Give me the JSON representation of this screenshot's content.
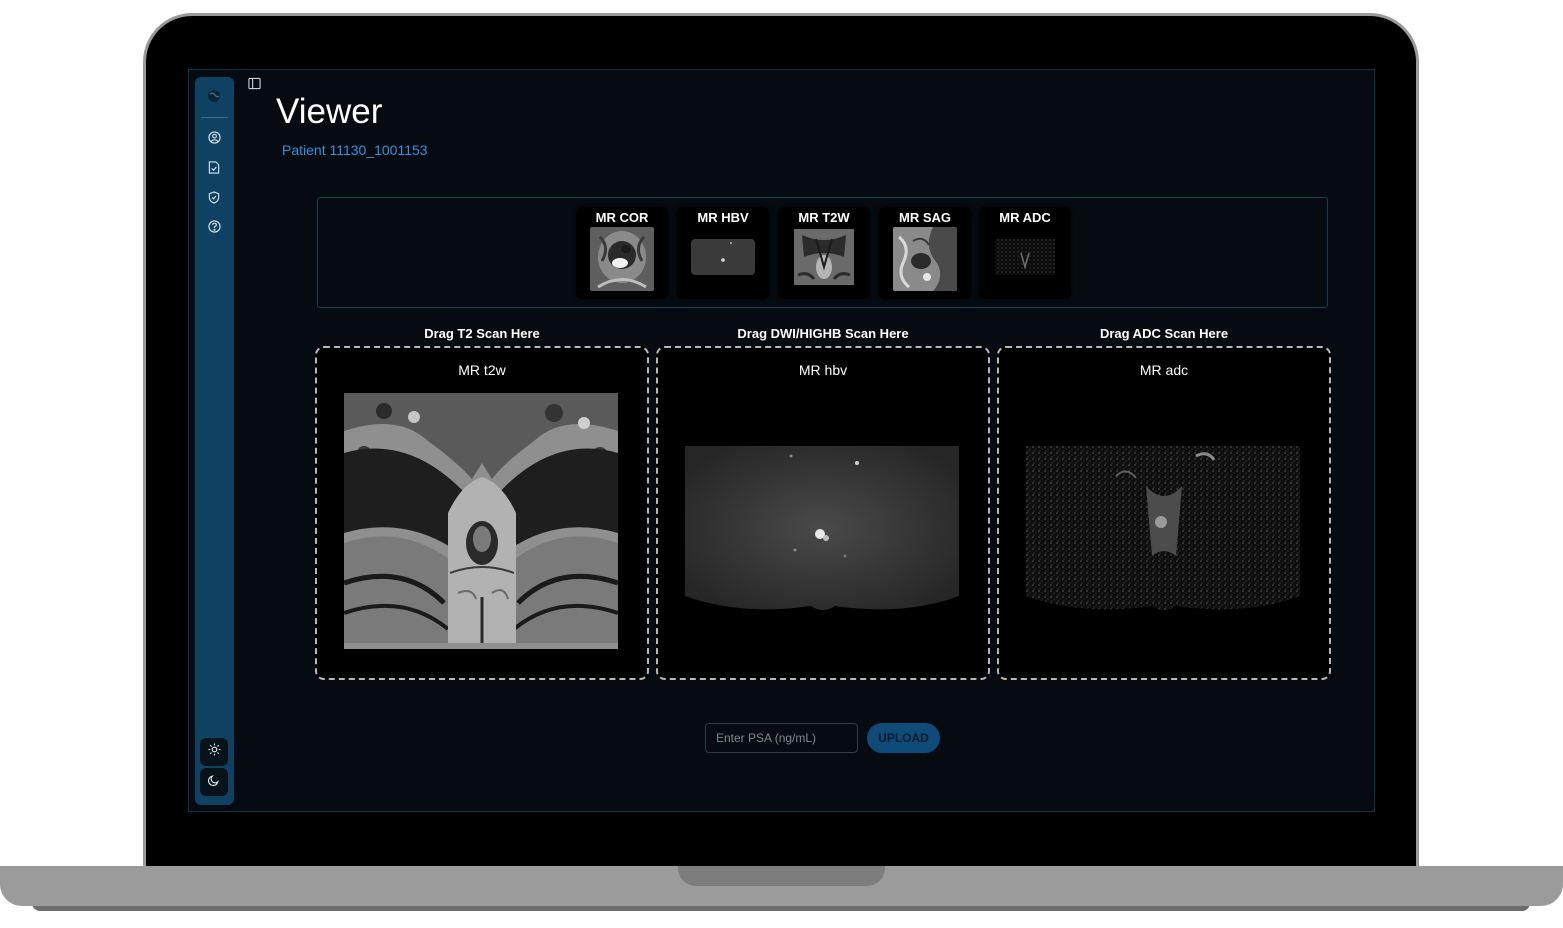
{
  "page": {
    "title": "Viewer",
    "patient": "Patient 11130_1001153"
  },
  "sidebar": {
    "items": [
      {
        "icon": "globe-icon"
      },
      {
        "icon": "user-circle-icon"
      },
      {
        "icon": "file-check-icon"
      },
      {
        "icon": "shield-icon"
      },
      {
        "icon": "help-circle-icon"
      }
    ],
    "theme_buttons": [
      {
        "icon": "sun-icon"
      },
      {
        "icon": "moon-icon"
      }
    ]
  },
  "series": [
    {
      "label": "MR COR"
    },
    {
      "label": "MR HBV"
    },
    {
      "label": "MR T2W"
    },
    {
      "label": "MR SAG"
    },
    {
      "label": "MR ADC"
    }
  ],
  "drop_zones": [
    {
      "label": "Drag T2 Scan Here",
      "title": "MR t2w"
    },
    {
      "label": "Drag DWI/HIGHB Scan Here",
      "title": "MR hbv"
    },
    {
      "label": "Drag ADC Scan Here",
      "title": "MR adc"
    }
  ],
  "psa": {
    "placeholder": "Enter PSA (ng/mL)",
    "value": ""
  },
  "upload": {
    "label": "UPLOAD"
  },
  "colors": {
    "background": "#050b11",
    "sidebar": "#0f4262",
    "accent": "#2f93de",
    "button": "#0e4b79"
  }
}
